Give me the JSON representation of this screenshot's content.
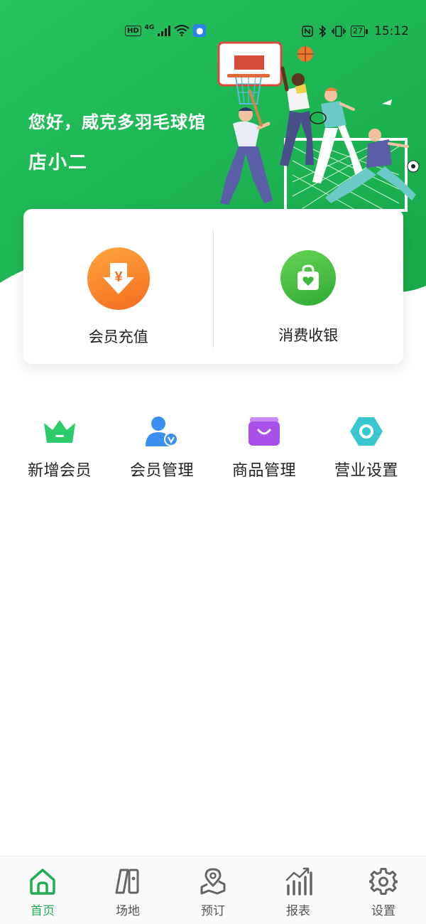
{
  "status_bar": {
    "left_badge": "HD",
    "network": "4G",
    "battery": "27",
    "time": "15:12"
  },
  "header": {
    "greeting": "您好，威克多羽毛球馆",
    "user_name": "店小二"
  },
  "main_actions": [
    {
      "label": "会员充值",
      "icon": "yuan-download-icon",
      "color": "#f77f26"
    },
    {
      "label": "消费收银",
      "icon": "shopping-bag-heart-icon",
      "color": "#3dba3d"
    }
  ],
  "quick_actions": [
    {
      "label": "新增会员",
      "icon": "crown-icon",
      "color": "#2ecb6b"
    },
    {
      "label": "会员管理",
      "icon": "member-verified-icon",
      "color": "#3b8ff0"
    },
    {
      "label": "商品管理",
      "icon": "shopping-basket-icon",
      "color": "#a950e8"
    },
    {
      "label": "营业设置",
      "icon": "hexagon-settings-icon",
      "color": "#38c6cf"
    }
  ],
  "bottom_nav": [
    {
      "label": "首页",
      "icon": "home-icon",
      "active": true
    },
    {
      "label": "场地",
      "icon": "venue-icon",
      "active": false
    },
    {
      "label": "预订",
      "icon": "location-booking-icon",
      "active": false
    },
    {
      "label": "报表",
      "icon": "report-chart-icon",
      "active": false
    },
    {
      "label": "设置",
      "icon": "gear-icon",
      "active": false
    }
  ],
  "colors": {
    "brand_green": "#1fb554",
    "active_nav": "#1fae54"
  }
}
